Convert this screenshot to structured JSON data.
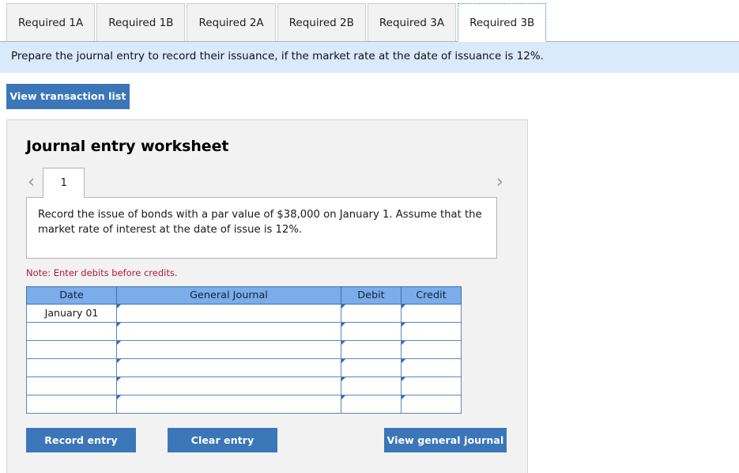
{
  "tabs": [
    {
      "label": "Required 1A",
      "active": false
    },
    {
      "label": "Required 1B",
      "active": false
    },
    {
      "label": "Required 2A",
      "active": false
    },
    {
      "label": "Required 2B",
      "active": false
    },
    {
      "label": "Required 3A",
      "active": false
    },
    {
      "label": "Required 3B",
      "active": true
    }
  ],
  "instruction": "Prepare the journal entry to record their issuance, if the market rate at the date of issuance is 12%.",
  "toolbar": {
    "view_transaction_list_label": "View transaction list"
  },
  "worksheet": {
    "title": "Journal entry worksheet",
    "prev_icon": "chevron-left-icon",
    "next_icon": "chevron-right-icon",
    "sheet_tabs": [
      "1"
    ],
    "description": "Record the issue of bonds with a par value of $38,000 on January 1. Assume that the market rate of interest at the date of issue is 12%.",
    "note": "Note: Enter debits before credits."
  },
  "table": {
    "headers": [
      "Date",
      "General Journal",
      "Debit",
      "Credit"
    ],
    "rows": [
      {
        "date": "January 01",
        "general_journal": "",
        "debit": "",
        "credit": ""
      },
      {
        "date": "",
        "general_journal": "",
        "debit": "",
        "credit": ""
      },
      {
        "date": "",
        "general_journal": "",
        "debit": "",
        "credit": ""
      },
      {
        "date": "",
        "general_journal": "",
        "debit": "",
        "credit": ""
      },
      {
        "date": "",
        "general_journal": "",
        "debit": "",
        "credit": ""
      },
      {
        "date": "",
        "general_journal": "",
        "debit": "",
        "credit": ""
      }
    ]
  },
  "actions": {
    "record_entry_label": "Record entry",
    "clear_entry_label": "Clear entry",
    "view_general_journal_label": "View general journal"
  },
  "colors": {
    "accent_blue": "#3b77b8",
    "banner_blue": "#d9eafa",
    "table_header_blue": "#7badea",
    "note_red": "#b01a3a",
    "panel_gray": "#f2f2f2"
  }
}
